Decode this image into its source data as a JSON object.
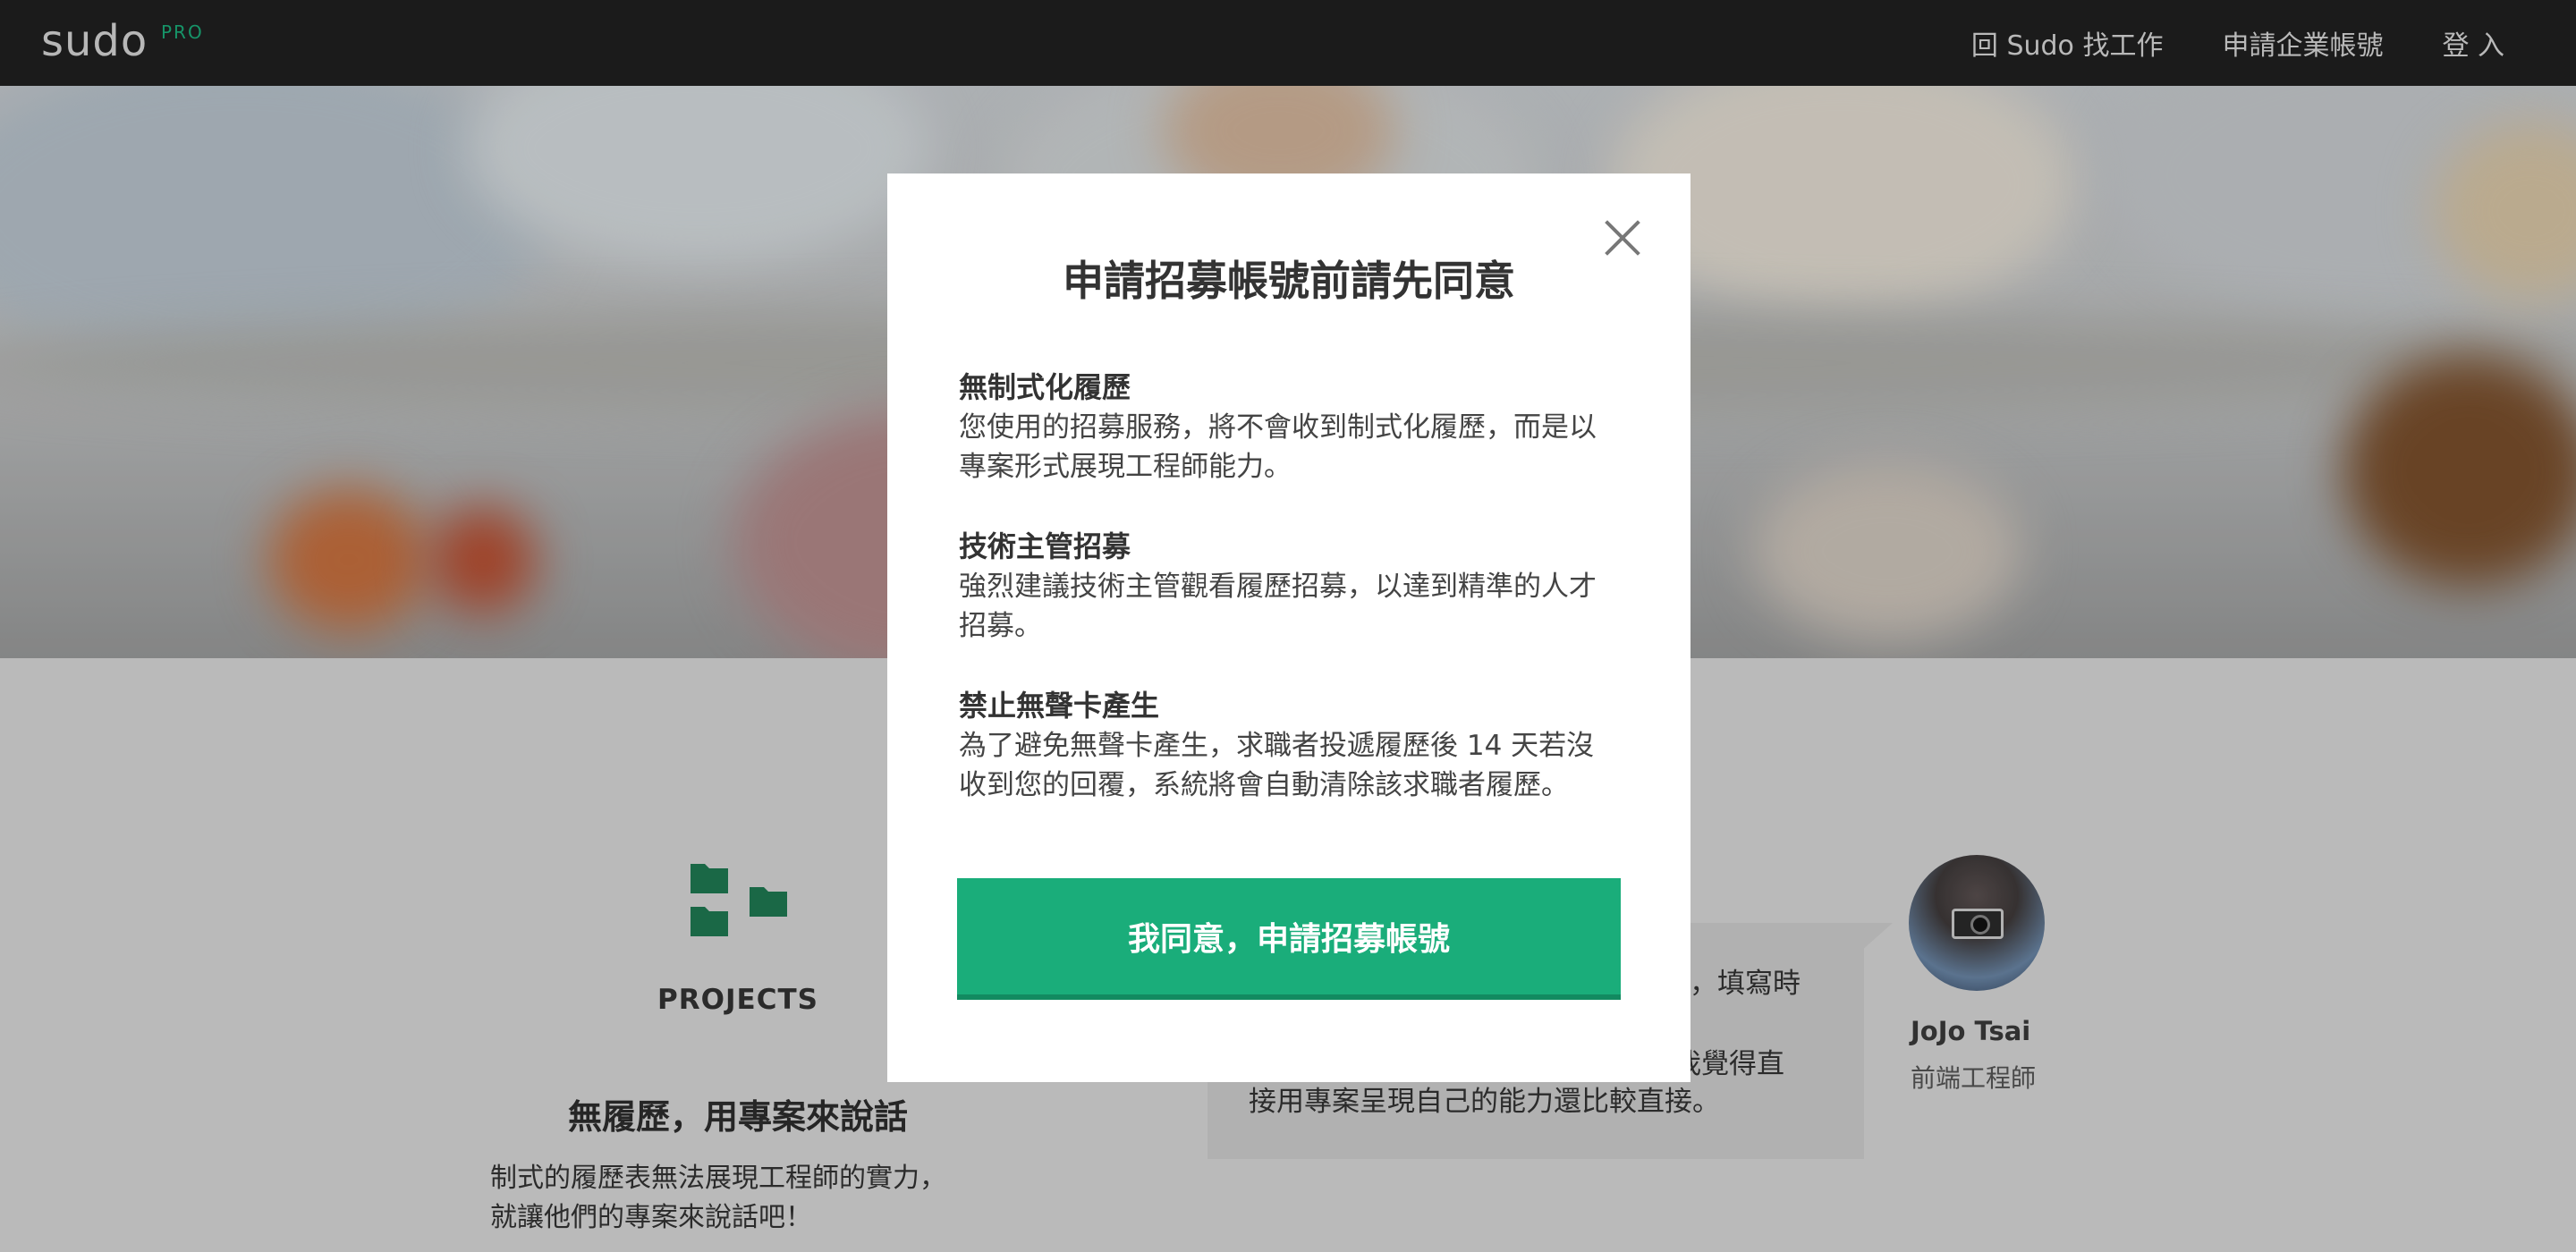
{
  "nav": {
    "logo": "sudo",
    "logo_sup": "PRO",
    "items": [
      {
        "label": "回 Sudo 找工作"
      },
      {
        "label": "申請企業帳號"
      },
      {
        "label": "登 入"
      }
    ]
  },
  "feature": {
    "icon": "folders-icon",
    "label": "PROJECTS",
    "title": "無履歷，用專案來說話",
    "desc_line1": "制式的履歷表無法展現工程師的實力，",
    "desc_line2": "就讓他們的專案來說話吧！"
  },
  "quote": {
    "line1": "力，填寫時",
    "line2": "那我覺得直",
    "line3": "接用專案呈現自己的能力還比較直接。",
    "author_name": "JoJo Tsai",
    "author_title": "前端工程師"
  },
  "modal": {
    "title": "申請招募帳號前請先同意",
    "terms": [
      {
        "heading": "無制式化履歷",
        "line1": "您使用的招募服務，將不會收到制式化履歷，而是以",
        "line2": "專案形式展現工程師能力。"
      },
      {
        "heading": "技術主管招募",
        "line1": "強烈建議技術主管觀看履歷招募，以達到精準的人才",
        "line2": "招募。"
      },
      {
        "heading": "禁止無聲卡產生",
        "line1": "為了避免無聲卡產生，求職者投遞履歷後 14 天若沒",
        "line2": "收到您的回覆，系統將會自動清除該求職者履歷。"
      }
    ],
    "agree_label": "我同意，申請招募帳號"
  },
  "colors": {
    "accent": "#1aad7a",
    "nav_bg": "#202020"
  }
}
